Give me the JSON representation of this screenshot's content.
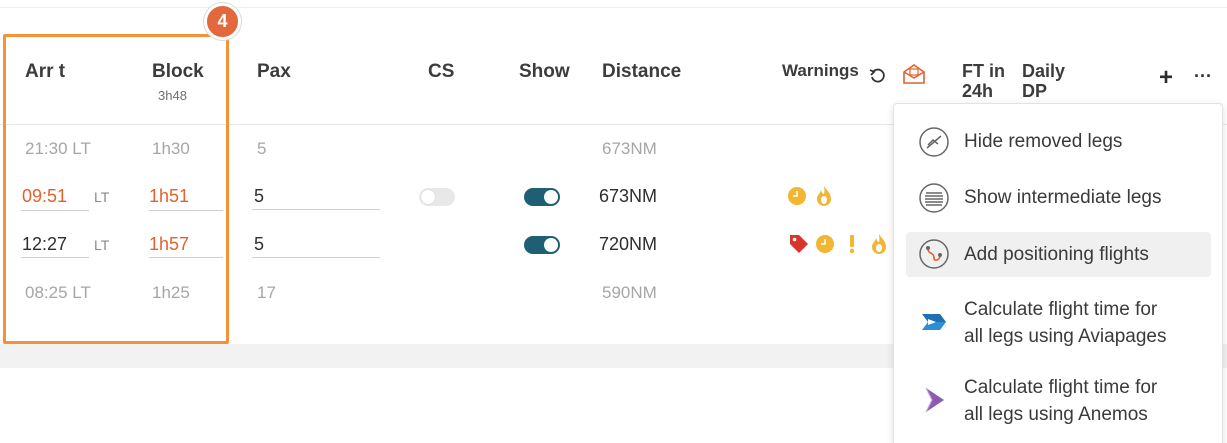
{
  "badge": "4",
  "columns": {
    "arr_t": "Arr t",
    "block": "Block",
    "block_total": "3h48",
    "pax": "Pax",
    "cs": "CS",
    "show": "Show",
    "distance": "Distance",
    "warnings": "Warnings",
    "ft_in_24h_line1": "FT in",
    "ft_in_24h_line2": "24h",
    "daily_dp_line1": "Daily",
    "daily_dp_line2": "DP",
    "add_label": "+",
    "more_label": "···"
  },
  "rows": [
    {
      "arr": "21:30 LT",
      "block": "1h30",
      "pax": "5",
      "distance": "673NM"
    },
    {
      "arr": "09:51",
      "lt": "LT",
      "block": "1h51",
      "pax": "5",
      "cs": false,
      "show": true,
      "distance": "673NM"
    },
    {
      "arr": "12:27",
      "lt": "LT",
      "block": "1h57",
      "pax": "5",
      "show": true,
      "distance": "720NM"
    },
    {
      "arr": "08:25 LT",
      "block": "1h25",
      "pax": "17",
      "distance": "590NM"
    }
  ],
  "menu": {
    "hide_removed": "Hide removed legs",
    "show_intermediate": "Show intermediate legs",
    "add_positioning": "Add positioning flights",
    "calc_aviapages_1": "Calculate flight time for",
    "calc_aviapages_2": "all legs using Aviapages",
    "calc_anemos_1": "Calculate flight time for",
    "calc_anemos_2": "all legs using Anemos"
  },
  "colors": {
    "accent_orange": "#e2622b",
    "highlight_border": "#f39237",
    "toggle_on": "#1f5f73",
    "warning_yellow": "#f2b632",
    "warning_red": "#d9342b"
  }
}
